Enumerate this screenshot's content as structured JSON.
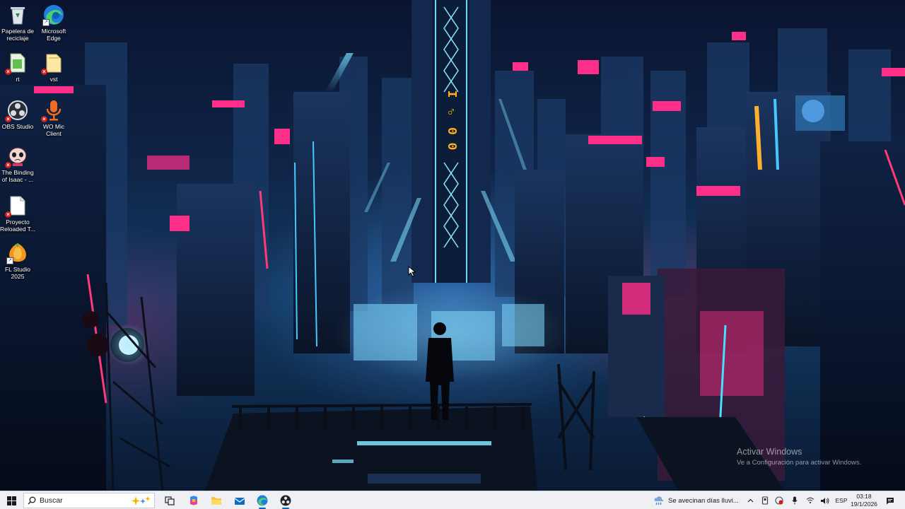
{
  "desktop": {
    "icons": [
      {
        "label": "Papelera de\nreciclaje",
        "icon": "recycle-bin-icon"
      },
      {
        "label": "Microsoft\nEdge",
        "icon": "edge-icon"
      },
      {
        "label": "rt",
        "icon": "file-icon"
      },
      {
        "label": "vst",
        "icon": "folder-icon"
      },
      {
        "label": "OBS Studio",
        "icon": "obs-icon"
      },
      {
        "label": "WO Mic\nClient",
        "icon": "microphone-icon"
      },
      {
        "label": "The Binding\nof Isaac - ...",
        "icon": "isaac-game-icon"
      },
      {
        "label": "Proyecto\nReloaded T...",
        "icon": "document-icon"
      },
      {
        "label": "FL Studio\n2025",
        "icon": "fl-studio-icon"
      }
    ],
    "wallpaper_sign": "I ♂ 0 0"
  },
  "watermark": {
    "title": "Activar Windows",
    "subtitle": "Ve a Configuración para activar Windows."
  },
  "taskbar": {
    "search_placeholder": "Buscar",
    "apps": [
      "task-view-icon",
      "copilot-icon",
      "file-explorer-icon",
      "mail-icon",
      "edge-icon",
      "obs-icon"
    ],
    "weather_text": "Se avecinan días lluvi...",
    "language": "ESP",
    "time": "03:18",
    "date": "19/1/2026"
  },
  "colors": {
    "taskbar_bg": "#eef0f4",
    "accent": "#0067c0",
    "neon_pink": "#ff2e88",
    "neon_cyan": "#37d4ff"
  }
}
